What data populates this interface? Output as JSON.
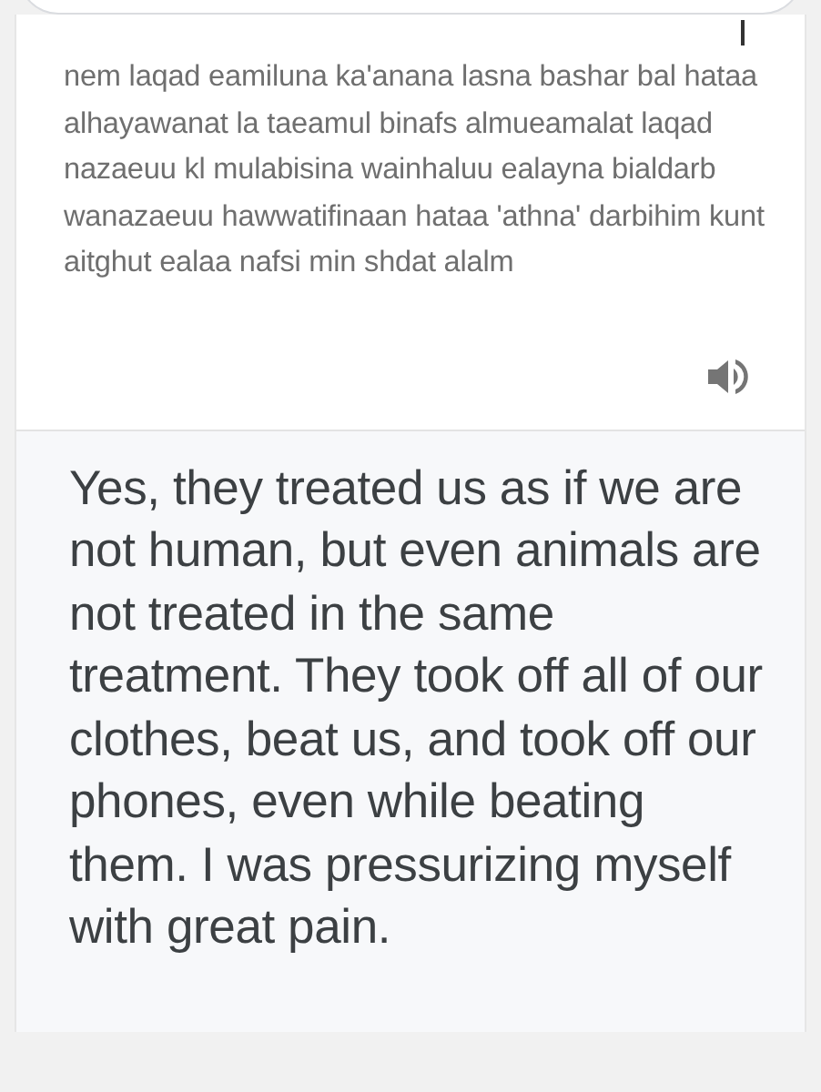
{
  "transliteration": "nem laqad eamiluna ka'anana lasna bashar bal hataa alhayawanat la taeamul binafs almueamalat laqad nazaeuu kl mulabisina wainhaluu ealayna bialdarb wanazaeuu hawwatifinaan hataa 'athna' darbihim kunt aitghut ealaa nafsi min shdat alalm",
  "translation": "Yes, they treated us as if we are not human, but even animals are not treated in the same treatment. They took off all of our clothes, beat us, and took off our phones, even while beating them. I was pressurizing myself with great pain."
}
